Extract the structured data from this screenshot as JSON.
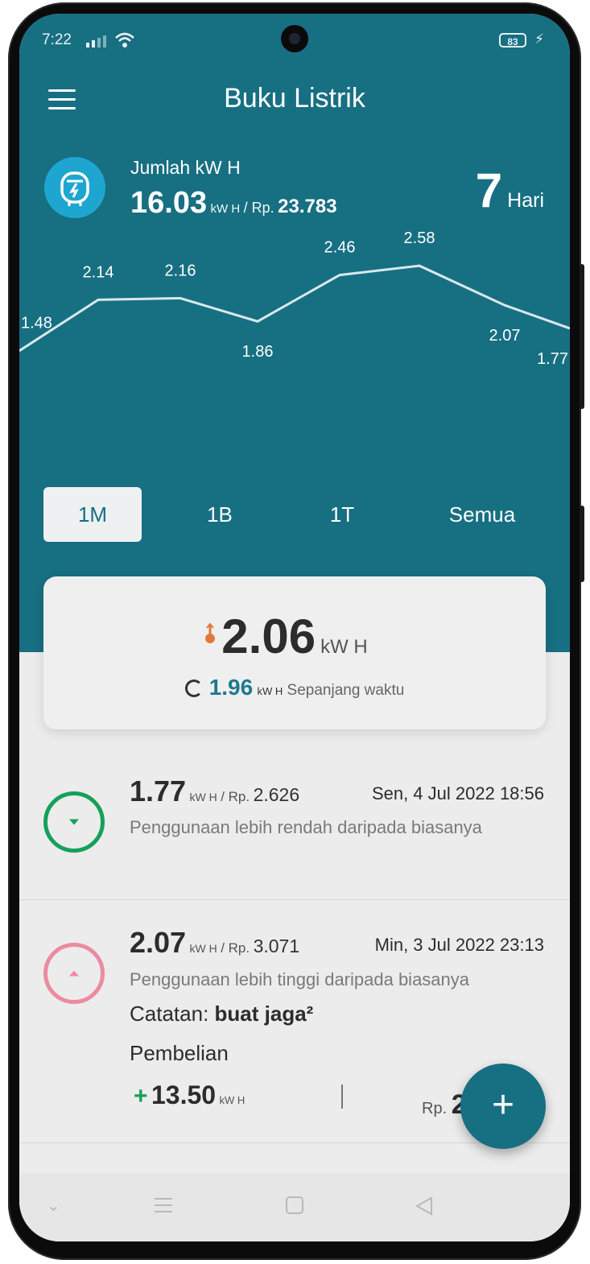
{
  "status": {
    "time": "7:22",
    "battery": "83"
  },
  "header": {
    "title": "Buku Listrik"
  },
  "summary": {
    "label": "Jumlah kW H",
    "total": "16.03",
    "unit": "kW H",
    "rp_prefix": "/ Rp.",
    "rp_value": "23.783",
    "days": "7",
    "days_label": "Hari"
  },
  "chart_data": {
    "type": "line",
    "values": [
      1.48,
      2.14,
      2.16,
      1.86,
      2.46,
      2.58,
      2.07,
      1.77
    ],
    "labels": [
      "1.48",
      "2.14",
      "2.16",
      "1.86",
      "2.46",
      "2.58",
      "2.07",
      "1.77"
    ],
    "line_color": "#d8e8ec"
  },
  "tabs": [
    {
      "label": "1M",
      "active": true
    },
    {
      "label": "1B",
      "active": false
    },
    {
      "label": "1T",
      "active": false
    },
    {
      "label": "Semua",
      "active": false
    }
  ],
  "average_card": {
    "value": "2.06",
    "unit": "kW H",
    "alltime_value": "1.96",
    "alltime_unit": "kW H",
    "alltime_label": "Sepanjang waktu"
  },
  "entries": [
    {
      "value": "1.77",
      "unit": "kW H",
      "rp_prefix": "/ Rp.",
      "rp": "2.626",
      "date": "Sen, 4 Jul 2022 18:56",
      "desc": "Penggunaan lebih rendah daripada biasanya",
      "trend": "down"
    },
    {
      "value": "2.07",
      "unit": "kW H",
      "rp_prefix": "/ Rp.",
      "rp": "3.071",
      "date": "Min, 3 Jul 2022 23:13",
      "desc": "Penggunaan lebih tinggi daripada biasanya",
      "note_label": "Catatan:",
      "note_value": "buat jaga²",
      "purchase_label": "Pembelian",
      "purchase_plus": "+",
      "purchase_value": "13.50",
      "purchase_unit": "kW H",
      "purchase_rp_prefix": "Rp.",
      "purchase_rp_partial": "2",
      "trend": "up"
    }
  ],
  "fab": {
    "label": "+"
  },
  "colors": {
    "primary": "#176f82",
    "green": "#16a05a",
    "pink": "#ec8ba0",
    "accent_orange": "#e07a3c"
  }
}
